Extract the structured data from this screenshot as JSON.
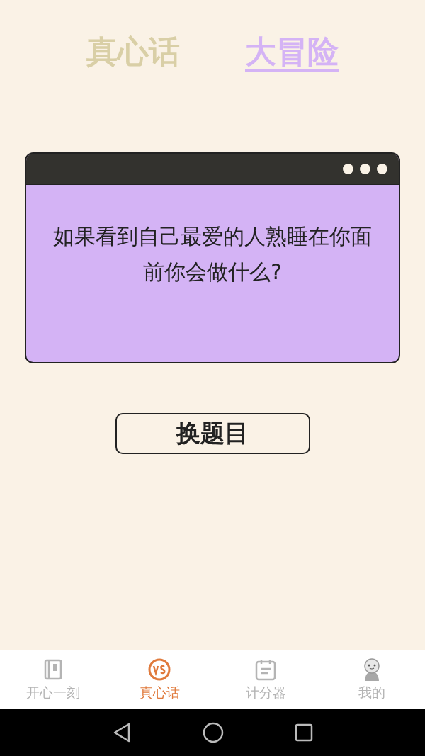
{
  "mode_tabs": [
    {
      "label": "真心话",
      "selected": false
    },
    {
      "label": "大冒险",
      "selected": true
    }
  ],
  "question_card": {
    "text": "如果看到自己最爱的人熟睡在你面前你会做什么?"
  },
  "change_button": {
    "label": "换题目"
  },
  "bottom_nav": [
    {
      "label": "开心一刻",
      "kind": "book",
      "selected": false
    },
    {
      "label": "真心话",
      "kind": "vs",
      "selected": true
    },
    {
      "label": "计分器",
      "kind": "calendar",
      "selected": false
    },
    {
      "label": "我的",
      "kind": "avatar",
      "selected": false
    }
  ]
}
